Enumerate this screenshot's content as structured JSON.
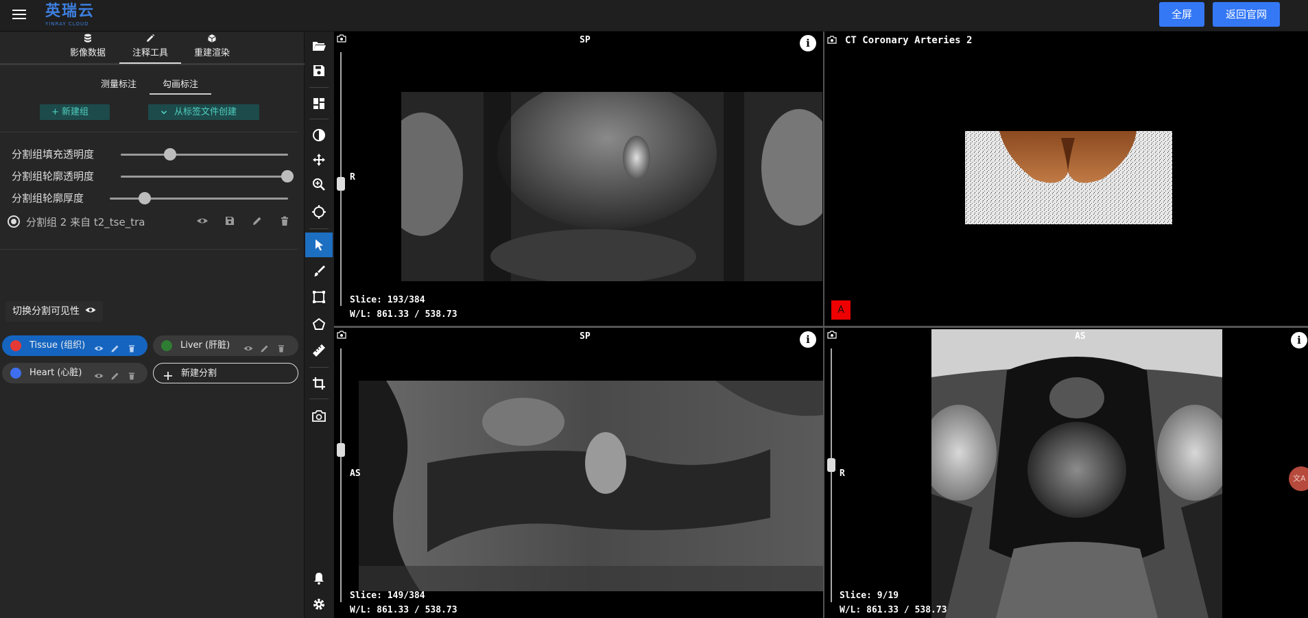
{
  "header": {
    "logo_main": "英瑞云",
    "logo_sub": "YINRAY CLOUD",
    "fullscreen_label": "全屏",
    "home_label": "返回官网"
  },
  "left_panel": {
    "main_tabs": [
      {
        "icon": "database-icon",
        "label": "影像数据"
      },
      {
        "icon": "pencil-icon",
        "label": "注释工具"
      },
      {
        "icon": "cube-icon",
        "label": "重建渲染"
      }
    ],
    "active_main_tab": "注释工具",
    "sub_tabs": [
      {
        "label": "测量标注"
      },
      {
        "label": "勾画标注"
      }
    ],
    "active_sub_tab": "勾画标注",
    "new_group_label": "新建组",
    "from_file_label": "从标签文件创建",
    "sliders": [
      {
        "label": "分割组填充透明度",
        "value": 0.3
      },
      {
        "label": "分割组轮廓透明度",
        "value": 1.0
      },
      {
        "label": "分割组轮廓厚度",
        "value": 0.2
      }
    ],
    "segmentation_group": "分割组 2 来自 t2_tse_tra",
    "toggle_visibility_label": "切换分割可见性",
    "segments": [
      {
        "label": "Tissue (组织)",
        "color": "#e53935",
        "active": true
      },
      {
        "label": "Liver (肝脏)",
        "color": "#2e7d32",
        "active": false
      },
      {
        "label": "Heart (心脏)",
        "color": "#3d6ff0",
        "active": false
      }
    ],
    "new_segment_label": "新建分割"
  },
  "viewports": {
    "top_left": {
      "top_label": "SP",
      "side_label": "R",
      "slice": "Slice: 193/384",
      "wl": "W/L: 861.33 / 538.73"
    },
    "top_right": {
      "title": "CT Coronary Arteries 2",
      "orientation_badge": "A"
    },
    "bottom_left": {
      "top_label": "SP",
      "side_label": "AS",
      "slice": "Slice: 149/384",
      "wl": "W/L: 861.33 / 538.73"
    },
    "bottom_right": {
      "top_label": "AS",
      "side_label": "R",
      "slice": "Slice: 9/19",
      "wl": "W/L: 861.33 / 538.73"
    }
  },
  "floating_button_label": "文A",
  "colors": {
    "accent": "#3478f6",
    "active_tool": "#1d6fc2",
    "teal": "#4fd0c0"
  }
}
